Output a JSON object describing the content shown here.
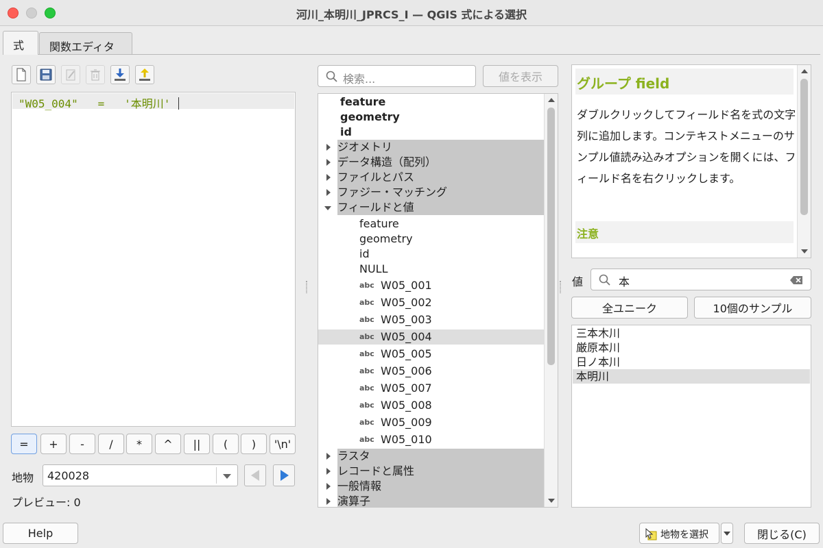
{
  "window": {
    "title": "河川_本明川_JPRCS_I — QGIS 式による選択"
  },
  "tabs": [
    "式",
    "関数エディタ"
  ],
  "editor": {
    "toolbar": [
      "new-file-icon",
      "save-icon",
      "edit-icon",
      "delete-icon",
      "import-icon",
      "export-icon"
    ],
    "code_parts": {
      "field": "\"W05_004\"",
      "op": "=",
      "value": "'本明川'"
    }
  },
  "operators": [
    "=",
    "+",
    "-",
    "/",
    "*",
    "^",
    "||",
    "(",
    ")",
    "'\\n'"
  ],
  "feature": {
    "label": "地物",
    "value": "420028"
  },
  "preview": {
    "label": "プレビュー:",
    "value": "0"
  },
  "search": {
    "placeholder": "検索...",
    "show_values_label": "値を表示"
  },
  "tree": {
    "top_items": [
      "feature",
      "geometry",
      "id"
    ],
    "groups_before": [
      "ジオメトリ",
      "データ構造（配列）",
      "ファイルとパス",
      "ファジー・マッチング"
    ],
    "expanded_group": "フィールドと値",
    "plain_children": [
      "feature",
      "geometry",
      "id",
      "NULL"
    ],
    "field_type": "abc",
    "fields": [
      "W05_001",
      "W05_002",
      "W05_003",
      "W05_004",
      "W05_005",
      "W05_006",
      "W05_007",
      "W05_008",
      "W05_009",
      "W05_010"
    ],
    "selected_field": "W05_004",
    "groups_after": [
      "ラスタ",
      "レコードと属性",
      "一般情報",
      "演算子"
    ]
  },
  "help": {
    "title": "グループ field",
    "body": "ダブルクリックしてフィールド名を式の文字列に追加します。コンテキストメニューのサンプル値読み込みオプションを開くには、フィールド名を右クリックします。",
    "note_title": "注意",
    "faded": "…… ……"
  },
  "values": {
    "label": "値",
    "search_value": "本",
    "all_unique_label": "全ユニーク",
    "sample_label": "10個のサンプル",
    "items": [
      "三本木川",
      "厳原本川",
      "日ノ本川",
      "本明川"
    ],
    "selected_item": "本明川"
  },
  "footer": {
    "help_label": "Help",
    "select_features_label": "地物を選択",
    "close_label": "閉じる(C)"
  },
  "colors": {
    "accent": "#8cb21f",
    "code": "#6b8e00",
    "nav_active": "#2f7bd8",
    "selection": "#dedede"
  }
}
